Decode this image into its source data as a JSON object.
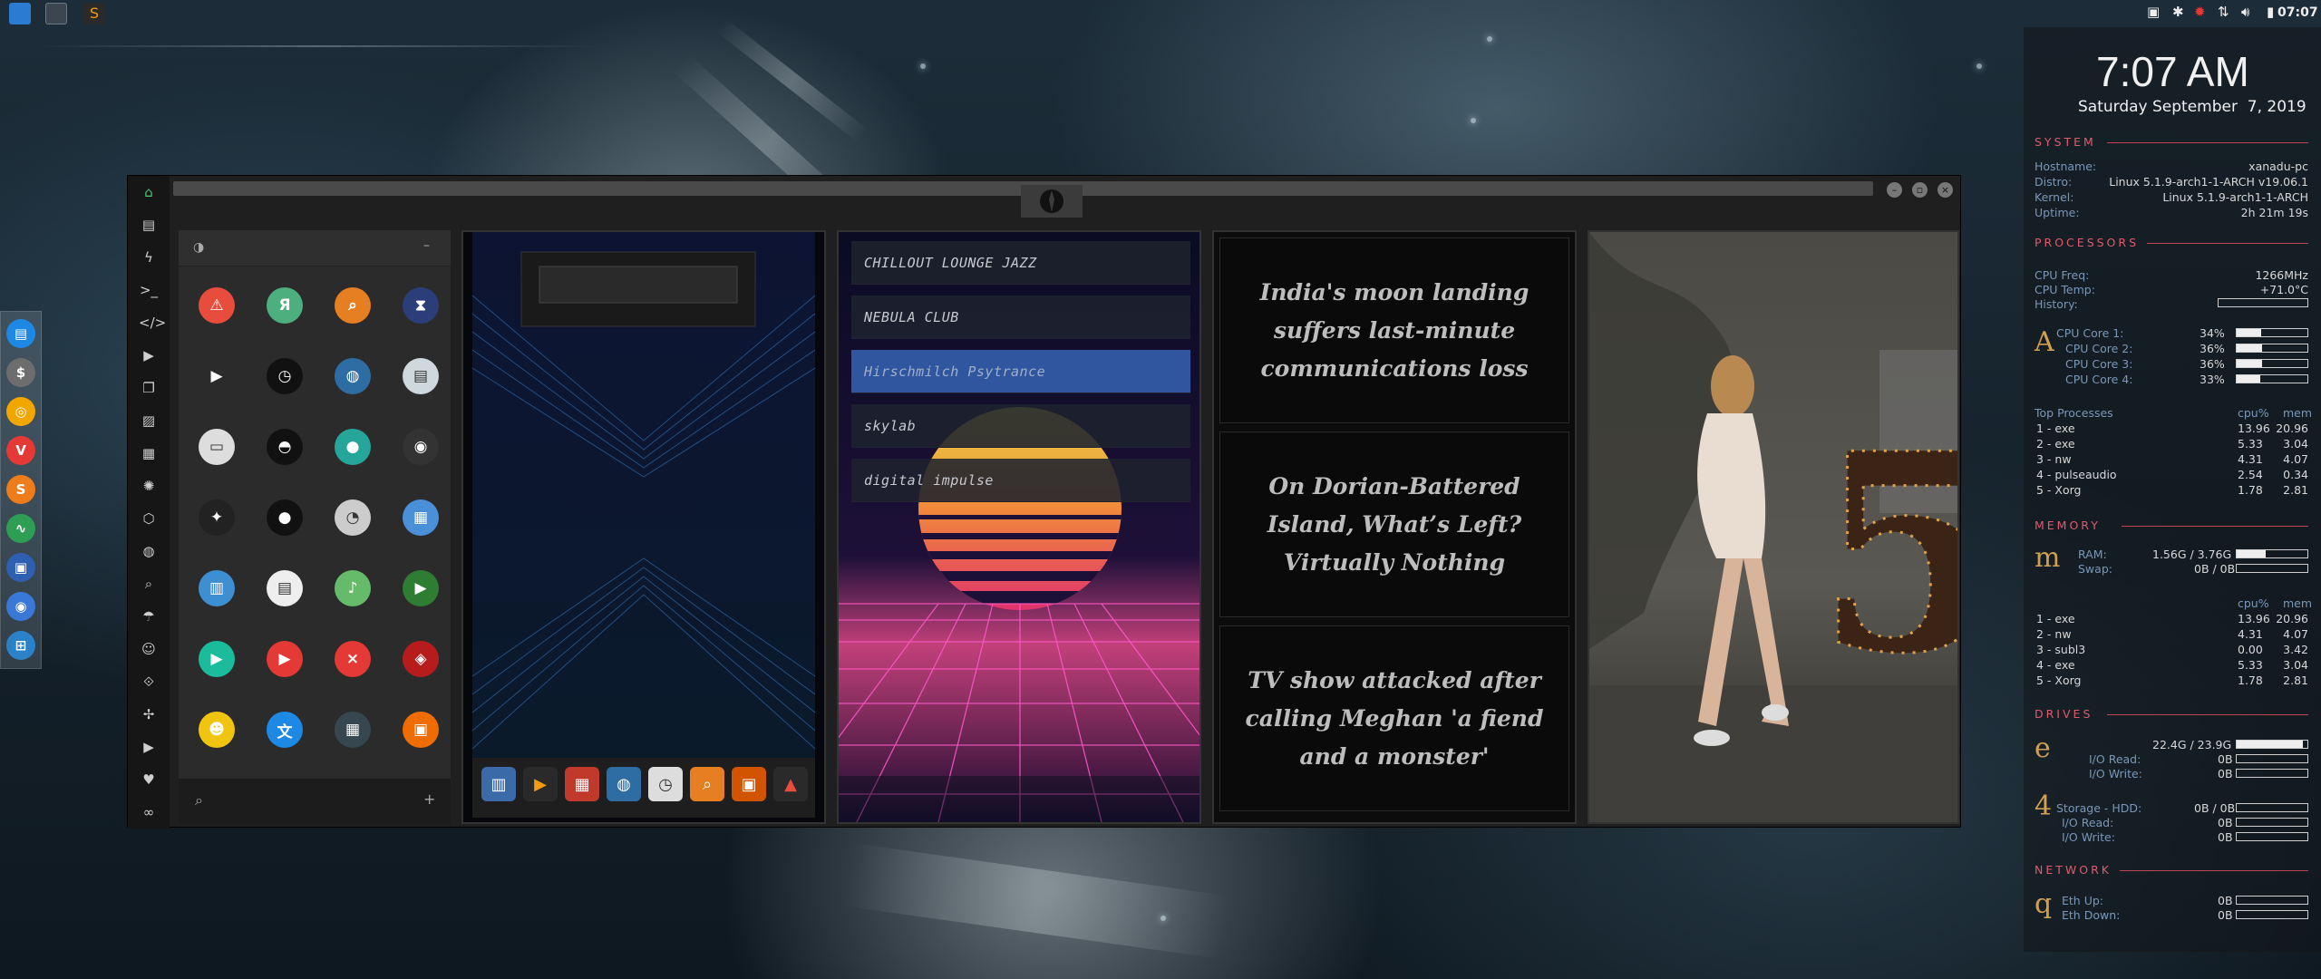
{
  "tray": {
    "time": "07:07"
  },
  "dock": {
    "apps": [
      {
        "icon": "files-icon",
        "glyph": "▤",
        "color": "#1e88e5"
      },
      {
        "icon": "money-icon",
        "glyph": "$",
        "color": "#6d6d6d"
      },
      {
        "icon": "ubuntu-icon",
        "glyph": "◎",
        "color": "#f2a600"
      },
      {
        "icon": "vivaldi-icon",
        "glyph": "V",
        "color": "#e53935"
      },
      {
        "icon": "sublime-icon",
        "glyph": "S",
        "color": "#ef7c1a"
      },
      {
        "icon": "system-monitor-icon",
        "glyph": "∿",
        "color": "#2e9e55"
      },
      {
        "icon": "screenshot-icon",
        "glyph": "▣",
        "color": "#2f5fb0"
      },
      {
        "icon": "chromium-icon",
        "glyph": "◉",
        "color": "#3a78d8"
      },
      {
        "icon": "workspace-icon",
        "glyph": "⊞",
        "color": "#2b82c9"
      }
    ]
  },
  "news": [
    "India's moon landing suffers last-minute communications loss",
    "On Dorian-Battered Island, What’s Left? Virtually Nothing",
    "TV show attacked after calling Meghan 'a fiend and a monster'"
  ],
  "radio": {
    "stations": [
      "CHILLOUT LOUNGE JAZZ",
      "NEBULA CLUB",
      "Hirschmilch Psytrance",
      "skylab",
      "digital impulse"
    ],
    "selected_index": 2
  },
  "conky": {
    "clock": "7:07 AM",
    "date": "Saturday September  7, 2019",
    "system": {
      "title": "SYSTEM",
      "rows": [
        {
          "label": "Hostname:",
          "value": "xanadu-pc"
        },
        {
          "label": "Distro:",
          "value": "Linux 5.1.9-arch1-1-ARCH v19.06.1"
        },
        {
          "label": "Kernel:",
          "value": "Linux 5.1.9-arch1-1-ARCH"
        },
        {
          "label": "Uptime:",
          "value": "2h 21m 19s"
        }
      ]
    },
    "processors": {
      "title": "PROCESSORS",
      "freq_label": "CPU Freq:",
      "freq": "1266MHz",
      "temp_label": "CPU Temp:",
      "temp": "+71.0°C",
      "history_label": "History:",
      "glyph": "A",
      "cores": [
        {
          "label": "CPU Core 1:",
          "value": "34%",
          "fill": 0.34
        },
        {
          "label": "CPU Core 2:",
          "value": "36%",
          "fill": 0.36
        },
        {
          "label": "CPU Core 3:",
          "value": "36%",
          "fill": 0.36
        },
        {
          "label": "CPU Core 4:",
          "value": "33%",
          "fill": 0.33
        }
      ],
      "top_label": "Top Processes",
      "col_cpu": "cpu%",
      "col_mem": "mem",
      "top": [
        {
          "name": "1 - exe",
          "cpu": "13.96",
          "mem": "20.96"
        },
        {
          "name": "2 - exe",
          "cpu": "5.33",
          "mem": "3.04"
        },
        {
          "name": "3 - nw",
          "cpu": "4.31",
          "mem": "4.07"
        },
        {
          "name": "4 - pulseaudio",
          "cpu": "2.54",
          "mem": "0.34"
        },
        {
          "name": "5 - Xorg",
          "cpu": "1.78",
          "mem": "2.81"
        }
      ]
    },
    "memory": {
      "title": "MEMORY",
      "glyph": "m",
      "ram_label": "RAM:",
      "ram": "1.56G / 3.76G",
      "ram_fill": 0.41,
      "swap_label": "Swap:",
      "swap": "0B / 0B",
      "swap_fill": 0,
      "col_cpu": "cpu%",
      "col_mem": "mem",
      "top": [
        {
          "name": "1 - exe",
          "cpu": "13.96",
          "mem": "20.96"
        },
        {
          "name": "2 - nw",
          "cpu": "4.31",
          "mem": "4.07"
        },
        {
          "name": "3 - subl3",
          "cpu": "0.00",
          "mem": "3.42"
        },
        {
          "name": "4 - exe",
          "cpu": "5.33",
          "mem": "3.04"
        },
        {
          "name": "5 - Xorg",
          "cpu": "1.78",
          "mem": "2.81"
        }
      ]
    },
    "drives": {
      "title": "DRIVES",
      "root": {
        "glyph": "e",
        "value": "22.4G / 23.9G",
        "fill": 0.94,
        "read_label": "I/O Read:",
        "read": "0B",
        "write_label": "I/O Write:",
        "write": "0B"
      },
      "storage": {
        "glyph": "4",
        "label": "Storage - HDD:",
        "value": "0B / 0B",
        "fill": 0,
        "read_label": "I/O Read:",
        "read": "0B",
        "write_label": "I/O Write:",
        "write": "0B"
      }
    },
    "network": {
      "title": "NETWORK",
      "glyph": "q",
      "up_label": "Eth Up:",
      "up": "0B",
      "down_label": "Eth Down:",
      "down": "0B"
    }
  }
}
